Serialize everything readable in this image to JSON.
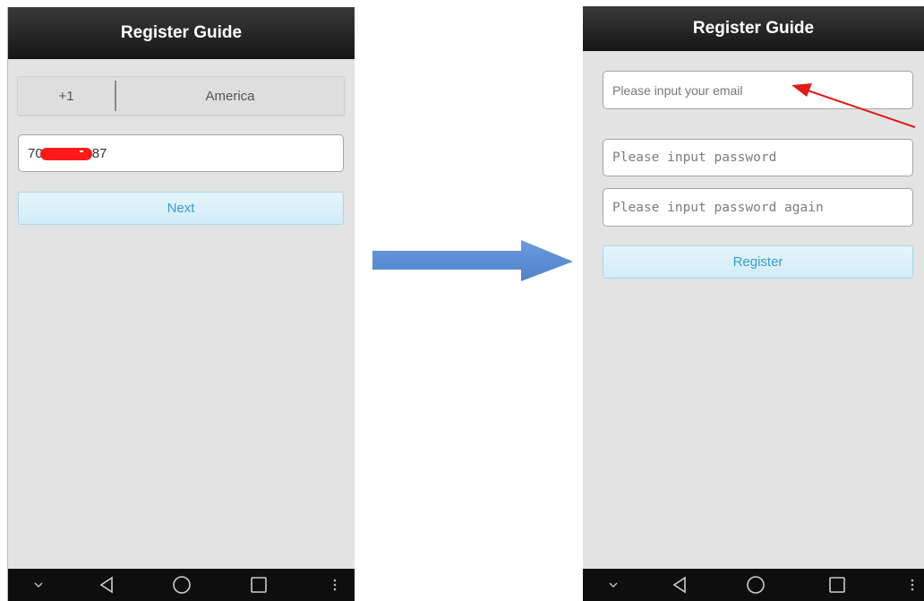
{
  "left_screen": {
    "title": "Register Guide",
    "country_code": "+1",
    "country_name": "America",
    "phone_prefix": "70",
    "phone_suffix": "87",
    "next_label": "Next"
  },
  "right_screen": {
    "title": "Register Guide",
    "email_placeholder": "Please input your email",
    "password_placeholder": "Please input password",
    "password_again_placeholder": "Please input password again",
    "register_label": "Register"
  },
  "navbar": {
    "icons": [
      "chevron-down-icon",
      "back-icon",
      "home-icon",
      "recents-icon",
      "menu-icon"
    ]
  },
  "colors": {
    "title_bar": "#1f1f1f",
    "screen_background": "#e3e3e3",
    "button_text": "#3a9bd0",
    "flow_arrow": "#5b8ed6",
    "annotation_arrow": "#e11a1a",
    "redaction": "#ff1a1a"
  }
}
